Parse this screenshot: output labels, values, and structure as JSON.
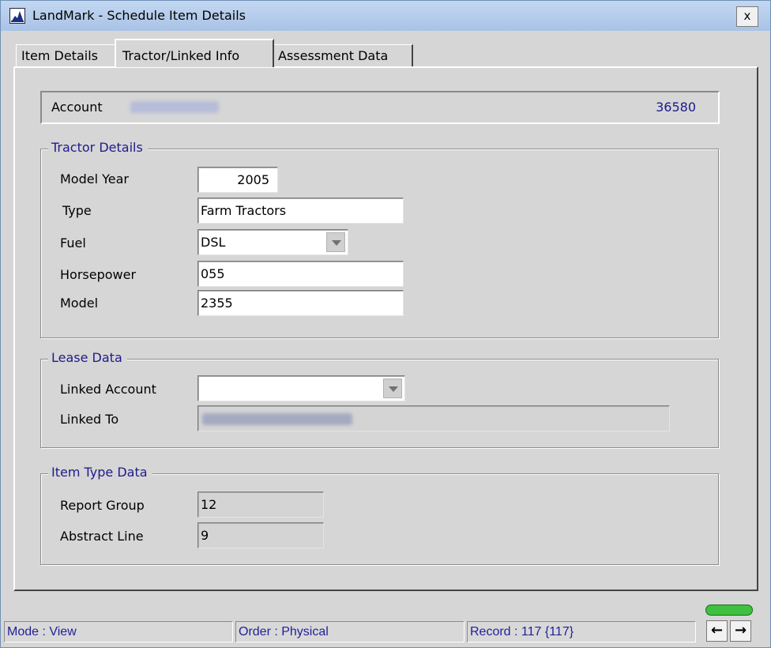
{
  "window": {
    "title": "LandMark - Schedule Item Details",
    "close_label": "x"
  },
  "tabs": [
    {
      "label": "Item Details"
    },
    {
      "label": "Tractor/Linked Info"
    },
    {
      "label": "Assessment Data"
    }
  ],
  "account": {
    "label": "Account",
    "number": "36580"
  },
  "tractor_details": {
    "legend": "Tractor Details",
    "model_year_label": "Model Year",
    "model_year": "2005",
    "type_label": "Type",
    "type": "Farm Tractors",
    "fuel_label": "Fuel",
    "fuel": "DSL",
    "horsepower_label": "Horsepower",
    "horsepower": "055",
    "model_label": "Model",
    "model": "2355"
  },
  "lease_data": {
    "legend": "Lease Data",
    "linked_account_label": "Linked Account",
    "linked_account": "",
    "linked_to_label": "Linked To"
  },
  "item_type_data": {
    "legend": "Item Type Data",
    "report_group_label": "Report Group",
    "report_group": "12",
    "abstract_line_label": "Abstract Line",
    "abstract_line": "9"
  },
  "status": {
    "mode": "Mode : View",
    "order": "Order : Physical",
    "record": "Record : 117 {117}"
  },
  "nav": {
    "prev": "←",
    "next": "→"
  },
  "colors": {
    "accent_text": "#1f1b8a",
    "title_bar": "#b5cbe9",
    "indicator": "#40c040"
  }
}
